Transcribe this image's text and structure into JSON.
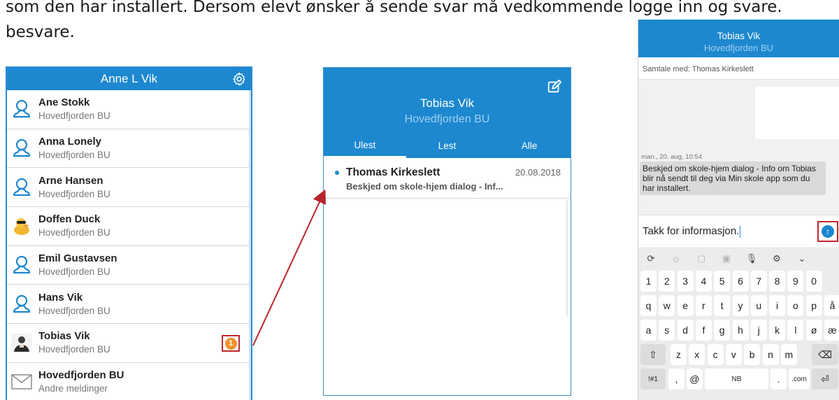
{
  "document": {
    "line1": "som den har installert. Dersom elevt ønsker å sende svar må vedkommende logge inn og svare.",
    "line2": "besvare."
  },
  "contacts_panel": {
    "title": "Anne L Vik",
    "settings_icon": "gear-icon",
    "contacts": [
      {
        "name": "Ane Stokk",
        "sub": "Hovedfjorden BU",
        "avatar": "person-outline-icon"
      },
      {
        "name": "Anna Lonely",
        "sub": "Hovedfjorden BU",
        "avatar": "person-outline-icon"
      },
      {
        "name": "Arne Hansen",
        "sub": "Hovedfjorden BU",
        "avatar": "person-outline-icon"
      },
      {
        "name": "Doffen Duck",
        "sub": "Hovedfjorden BU",
        "avatar": "duck-avatar"
      },
      {
        "name": "Emil Gustavsen",
        "sub": "Hovedfjorden BU",
        "avatar": "person-outline-icon"
      },
      {
        "name": "Hans Vik",
        "sub": "Hovedfjorden BU",
        "avatar": "person-outline-icon"
      },
      {
        "name": "Tobias Vik",
        "sub": "Hovedfjorden BU",
        "avatar": "photo-avatar",
        "unread": "1"
      },
      {
        "name": "Hovedfjorden BU",
        "sub": "Andre meldinger",
        "avatar": "envelope-icon"
      }
    ]
  },
  "inbox_panel": {
    "title": "Tobias Vik",
    "subtitle": "Hovedfjorden BU",
    "compose_icon": "compose-icon",
    "tabs": [
      {
        "label": "Ulest",
        "active": true
      },
      {
        "label": "Lest",
        "active": false
      },
      {
        "label": "Alle",
        "active": false
      }
    ],
    "messages": [
      {
        "from": "Thomas Kirkeslett",
        "date": "20.08.2018",
        "preview": "Beskjed om skole-hjem dialog - Inf..."
      }
    ]
  },
  "conversation_panel": {
    "title": "Tobias Vik",
    "subtitle": "Hovedfjorden BU",
    "conversation_with": "Samtale med:  Thomas Kirkeslett",
    "message_meta": "man., 20. aug, 10:54",
    "message_text": "Beskjed om skole-hjem dialog - Info om Tobias blir nå sendt til deg via Min skole app som du har installert.",
    "input_value": "Takk for informasjon.",
    "send_icon": "send-arrow-icon",
    "keyboard": {
      "numbers": [
        "1",
        "2",
        "3",
        "4",
        "5",
        "6",
        "7",
        "8",
        "9",
        "0"
      ],
      "row1": [
        "q",
        "w",
        "e",
        "r",
        "t",
        "y",
        "u",
        "i",
        "o",
        "p",
        "å"
      ],
      "row2": [
        "a",
        "s",
        "d",
        "f",
        "g",
        "h",
        "j",
        "k",
        "l",
        "ø",
        "æ"
      ],
      "row3": [
        "z",
        "x",
        "c",
        "v",
        "b",
        "n",
        "m"
      ],
      "shift": "⇧",
      "backspace": "⌫",
      "sym": "!#1",
      "comma": ",",
      "at": "@",
      "lang": "NB",
      "period": ".",
      "dotcom": ".com",
      "enter": "⏎"
    }
  },
  "colors": {
    "header_blue": "#1d88cf",
    "unread_orange": "#f0912e",
    "highlight_red": "#c0272d"
  }
}
